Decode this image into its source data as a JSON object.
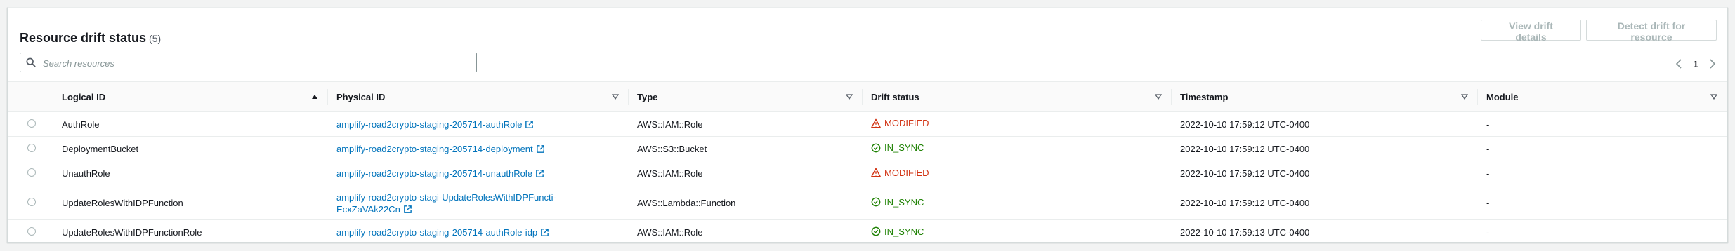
{
  "header": {
    "title": "Resource drift status",
    "count": "(5)",
    "view_button": "View drift details",
    "detect_button": "Detect drift for resource"
  },
  "search": {
    "placeholder": "Search resources",
    "value": ""
  },
  "pagination": {
    "page": "1"
  },
  "columns": {
    "logical_id": "Logical ID",
    "physical_id": "Physical ID",
    "type": "Type",
    "drift_status": "Drift status",
    "timestamp": "Timestamp",
    "module": "Module"
  },
  "icons": {
    "search": "search-icon",
    "sort_asc": "caret-up-icon",
    "sort_filter": "caret-down-icon",
    "external": "external-link-icon",
    "modified": "warning-icon",
    "in_sync": "check-circle-icon"
  },
  "colors": {
    "link": "#0073bb",
    "modified": "#d13212",
    "in_sync": "#1d8102",
    "disabled_button": "#aab7b8"
  },
  "rows": [
    {
      "logical_id": "AuthRole",
      "physical_id_line1": "amplify-road2crypto-staging-205714-authRole",
      "physical_id_line2": "",
      "type": "AWS::IAM::Role",
      "drift_status": "MODIFIED",
      "timestamp": "2022-10-10 17:59:12 UTC-0400",
      "module": "-"
    },
    {
      "logical_id": "DeploymentBucket",
      "physical_id_line1": "amplify-road2crypto-staging-205714-deployment",
      "physical_id_line2": "",
      "type": "AWS::S3::Bucket",
      "drift_status": "IN_SYNC",
      "timestamp": "2022-10-10 17:59:12 UTC-0400",
      "module": "-"
    },
    {
      "logical_id": "UnauthRole",
      "physical_id_line1": "amplify-road2crypto-staging-205714-unauthRole",
      "physical_id_line2": "",
      "type": "AWS::IAM::Role",
      "drift_status": "MODIFIED",
      "timestamp": "2022-10-10 17:59:12 UTC-0400",
      "module": "-"
    },
    {
      "logical_id": "UpdateRolesWithIDPFunction",
      "physical_id_line1": "amplify-road2crypto-stagi-UpdateRolesWithIDPFuncti-",
      "physical_id_line2": "EcxZaVAk22Cn",
      "type": "AWS::Lambda::Function",
      "drift_status": "IN_SYNC",
      "timestamp": "2022-10-10 17:59:12 UTC-0400",
      "module": "-"
    },
    {
      "logical_id": "UpdateRolesWithIDPFunctionRole",
      "physical_id_line1": "amplify-road2crypto-staging-205714-authRole-idp",
      "physical_id_line2": "",
      "type": "AWS::IAM::Role",
      "drift_status": "IN_SYNC",
      "timestamp": "2022-10-10 17:59:13 UTC-0400",
      "module": "-"
    }
  ]
}
